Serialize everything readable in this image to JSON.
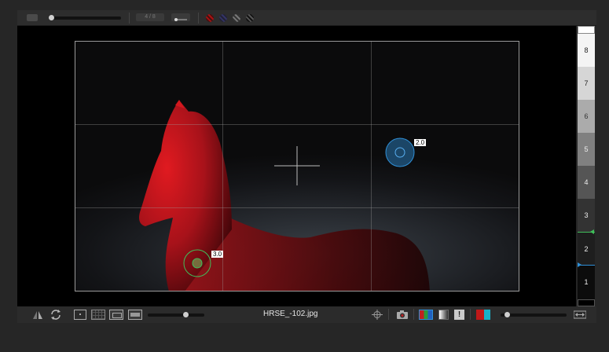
{
  "toolbar": {
    "page_counter": "4 / 8",
    "icons": [
      "panel-toggle-icon",
      "exposure-slider",
      "page-counter",
      "link-slider-icon",
      "overlay-red-icon",
      "overlay-blue-icon",
      "overlay-gray-icon",
      "overlay-black-icon"
    ]
  },
  "viewer": {
    "markers": [
      {
        "label": "2.0",
        "color": "#2f8fd6"
      },
      {
        "label": "3.0",
        "color": "#3fbf5a"
      }
    ]
  },
  "zones": {
    "labels": [
      "8",
      "7",
      "6",
      "5",
      "4",
      "3",
      "2",
      "1"
    ]
  },
  "bottombar": {
    "filename": "HRSE_-102.jpg",
    "zoom_level": 0.67,
    "right_slider_level": 0.1
  },
  "colors": {
    "accent_blue": "#2f8fd6",
    "accent_green": "#3fbf5a",
    "horse_red": "#c0141a"
  }
}
